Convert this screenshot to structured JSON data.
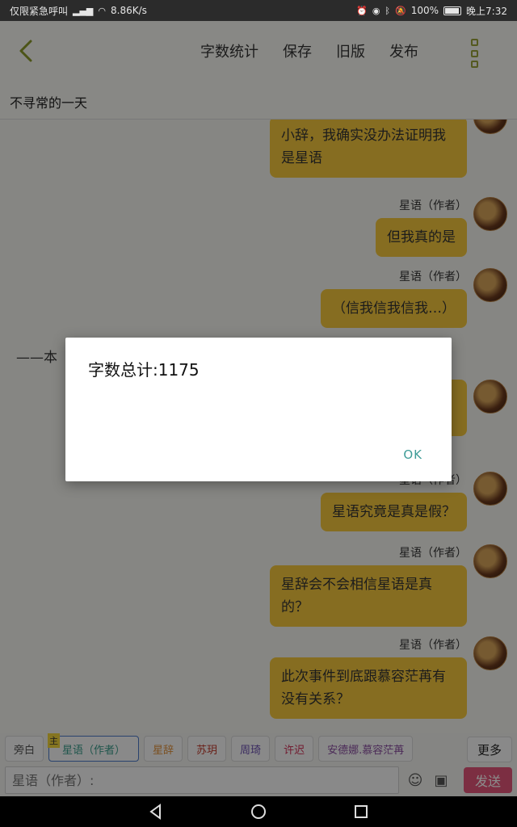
{
  "status_bar": {
    "carrier": "仅限紧急呼叫",
    "speed": "8.86K/s",
    "battery": "100%",
    "time": "晚上7:32"
  },
  "app_bar": {
    "menu": [
      "字数统计",
      "保存",
      "旧版",
      "发布"
    ]
  },
  "story_title": "不寻常的一天",
  "messages": [
    {
      "author": "",
      "text": "小辞，我确实没办法证明我是星语"
    },
    {
      "author": "星语（作者）",
      "text": "但我真的是"
    },
    {
      "author": "星语（作者）",
      "text": "（信我信我信我…）"
    },
    {
      "author": "星语（作者）",
      "text": "星语究竟是真是假？"
    },
    {
      "author": "星语（作者）",
      "text": "星辞会不会相信星语是真的？"
    },
    {
      "author": "星语（作者）",
      "text": "此次事件到底跟慕容茫苒有没有关系？"
    }
  ],
  "partial_system_line": "——本",
  "character_chips": [
    {
      "label": "旁白",
      "color": "#555555"
    },
    {
      "label": "星语（作者）",
      "color": "#3a9c8a",
      "flag": "主",
      "selected": true
    },
    {
      "label": "星辞",
      "color": "#e0903a"
    },
    {
      "label": "苏玥",
      "color": "#c0392b"
    },
    {
      "label": "周琦",
      "color": "#6a4fb0"
    },
    {
      "label": "许迟",
      "color": "#d0345a"
    },
    {
      "label": "安德娜.慕容茫苒",
      "color": "#8a4fa0"
    }
  ],
  "more_label": "更多",
  "input": {
    "placeholder": "星语（作者）:"
  },
  "send_label": "发送",
  "dialog": {
    "message": "字数总计:1175",
    "ok": "OK"
  }
}
